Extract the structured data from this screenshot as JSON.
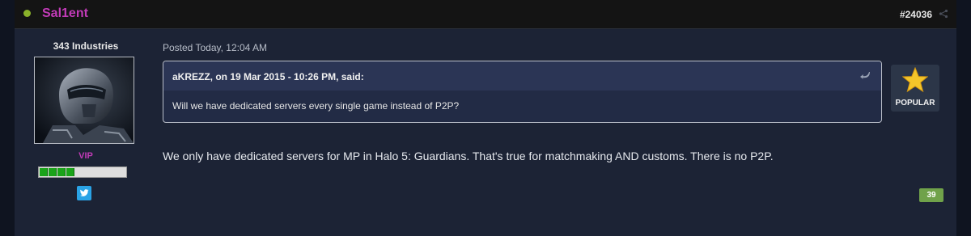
{
  "post": {
    "author_name": "Sal1ent",
    "post_number": "#24036",
    "posted_date": "Posted Today, 12:04 AM",
    "body": "We only have dedicated servers for MP in Halo 5: Guardians. That's true for matchmaking AND customs. There is no P2P.",
    "reputation_count": "39",
    "badge": {
      "label": "POPULAR",
      "icon": "star-icon"
    }
  },
  "author_pane": {
    "group": "343 Industries",
    "rank_title": "VIP",
    "reputation_level": 4,
    "reputation_max": 10,
    "social_icon": "twitter-icon"
  },
  "quote": {
    "citation": "aKREZZ, on 19 Mar 2015 - 10:26 PM, said:",
    "body": "Will we have dedicated servers every single game instead of P2P?",
    "snapback_icon": "snapback-icon"
  },
  "colors": {
    "author_name": "#c23bb8",
    "online_dot": "#8ab22a",
    "reputation_badge": "#70a24a",
    "twitter": "#2aa3e6",
    "background": "#1c2335"
  }
}
